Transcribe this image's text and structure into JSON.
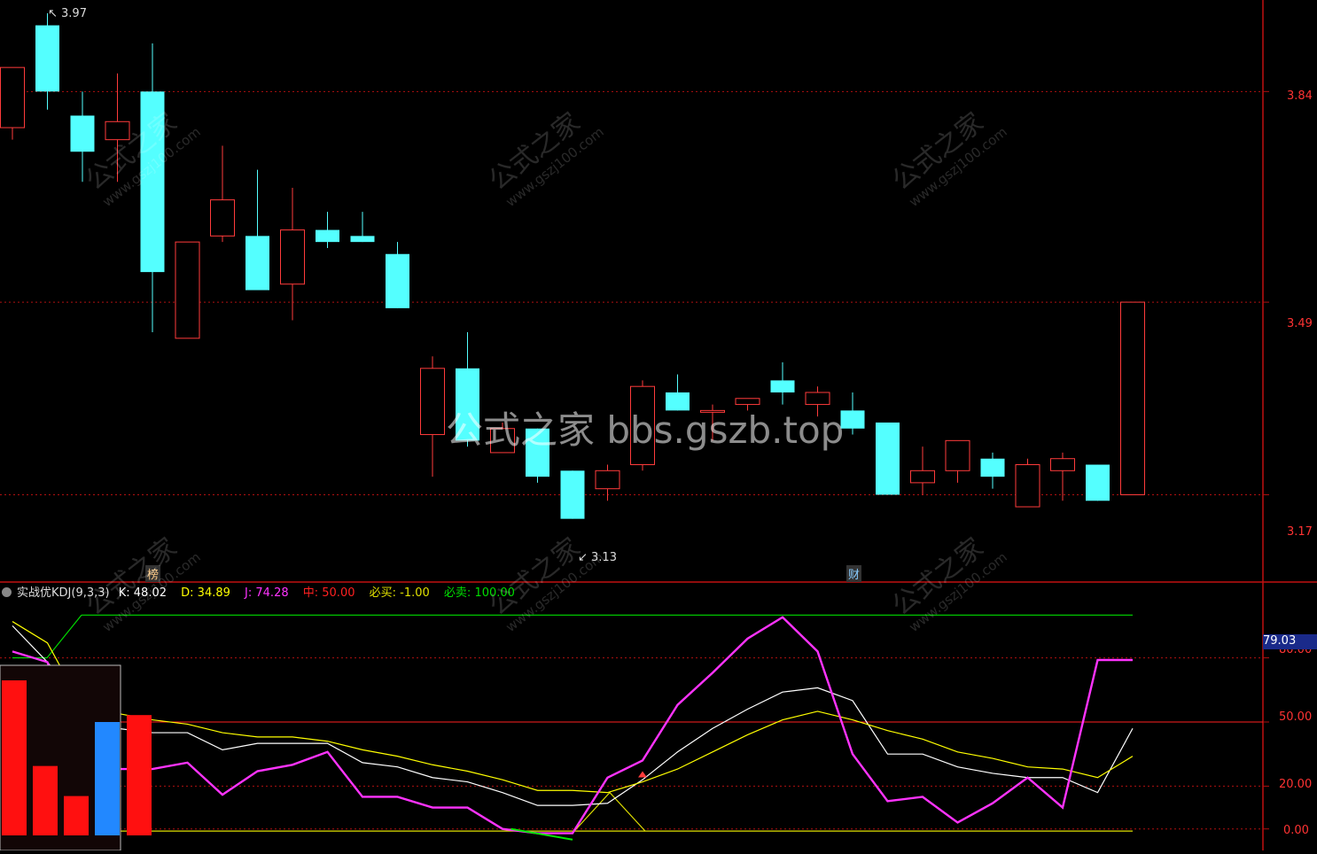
{
  "colors": {
    "up": "#ff3b3b",
    "down": "#54ffff",
    "k_line": "#ffffff",
    "d_line": "#ffff00",
    "j_line": "#ff33ff",
    "mid_line": "#ff2020",
    "sell_line": "#00dd00",
    "buy_line": "#e0e000",
    "grid": "#b01010",
    "bars_red": "#ff1010",
    "bars_blue": "#2288ff"
  },
  "watermark": {
    "center": "公式之家 bbs.gszb.top",
    "diagonal_cn": "公式之家",
    "diagonal_url": "www.gszj100.com"
  },
  "chart_data": [
    {
      "type": "candlestick",
      "title": "",
      "y_axis_labels": [
        "3.84",
        "3.49",
        "3.17"
      ],
      "ylim": [
        3.05,
        3.97
      ],
      "high_label": "3.97",
      "low_label": "3.13",
      "candles": [
        {
          "o": 3.78,
          "h": 3.86,
          "l": 3.76,
          "c": 3.88
        },
        {
          "o": 3.95,
          "h": 3.97,
          "l": 3.81,
          "c": 3.84
        },
        {
          "o": 3.8,
          "h": 3.84,
          "l": 3.69,
          "c": 3.74
        },
        {
          "o": 3.76,
          "h": 3.87,
          "l": 3.69,
          "c": 3.79
        },
        {
          "o": 3.84,
          "h": 3.92,
          "l": 3.44,
          "c": 3.54
        },
        {
          "o": 3.43,
          "h": 3.58,
          "l": 3.44,
          "c": 3.59
        },
        {
          "o": 3.6,
          "h": 3.75,
          "l": 3.59,
          "c": 3.66
        },
        {
          "o": 3.6,
          "h": 3.71,
          "l": 3.51,
          "c": 3.51
        },
        {
          "o": 3.52,
          "h": 3.68,
          "l": 3.46,
          "c": 3.61
        },
        {
          "o": 3.61,
          "h": 3.64,
          "l": 3.58,
          "c": 3.59
        },
        {
          "o": 3.6,
          "h": 3.64,
          "l": 3.59,
          "c": 3.59
        },
        {
          "o": 3.57,
          "h": 3.59,
          "l": 3.48,
          "c": 3.48
        },
        {
          "o": 3.27,
          "h": 3.4,
          "l": 3.2,
          "c": 3.38
        },
        {
          "o": 3.38,
          "h": 3.44,
          "l": 3.25,
          "c": 3.26
        },
        {
          "o": 3.24,
          "h": 3.29,
          "l": 3.26,
          "c": 3.28
        },
        {
          "o": 3.28,
          "h": 3.28,
          "l": 3.19,
          "c": 3.2
        },
        {
          "o": 3.21,
          "h": 3.21,
          "l": 3.13,
          "c": 3.13
        },
        {
          "o": 3.18,
          "h": 3.22,
          "l": 3.16,
          "c": 3.21
        },
        {
          "o": 3.22,
          "h": 3.36,
          "l": 3.21,
          "c": 3.35
        },
        {
          "o": 3.34,
          "h": 3.37,
          "l": 3.31,
          "c": 3.31
        },
        {
          "o": 3.31,
          "h": 3.32,
          "l": 3.26,
          "c": 3.31
        },
        {
          "o": 3.32,
          "h": 3.33,
          "l": 3.31,
          "c": 3.33
        },
        {
          "o": 3.36,
          "h": 3.39,
          "l": 3.32,
          "c": 3.34
        },
        {
          "o": 3.32,
          "h": 3.35,
          "l": 3.3,
          "c": 3.34
        },
        {
          "o": 3.31,
          "h": 3.34,
          "l": 3.27,
          "c": 3.28
        },
        {
          "o": 3.29,
          "h": 3.29,
          "l": 3.17,
          "c": 3.17
        },
        {
          "o": 3.19,
          "h": 3.25,
          "l": 3.17,
          "c": 3.21
        },
        {
          "o": 3.21,
          "h": 3.24,
          "l": 3.19,
          "c": 3.26
        },
        {
          "o": 3.23,
          "h": 3.24,
          "l": 3.18,
          "c": 3.2
        },
        {
          "o": 3.15,
          "h": 3.23,
          "l": 3.15,
          "c": 3.22
        },
        {
          "o": 3.21,
          "h": 3.24,
          "l": 3.16,
          "c": 3.23
        },
        {
          "o": 3.22,
          "h": 3.22,
          "l": 3.16,
          "c": 3.16
        },
        {
          "o": 3.17,
          "h": 3.49,
          "l": 3.17,
          "c": 3.49
        }
      ],
      "markers": [
        {
          "index": 4,
          "text": "榜"
        },
        {
          "index": 24,
          "text": "财"
        }
      ]
    },
    {
      "type": "line",
      "title": "实战优KDJ(9,3,3)",
      "legend": [
        {
          "name": "K",
          "value": "48.02"
        },
        {
          "name": "D",
          "value": "34.89"
        },
        {
          "name": "J",
          "value": "74.28"
        },
        {
          "name": "中",
          "value": "50.00"
        },
        {
          "name": "必买",
          "value": "-1.00"
        },
        {
          "name": "必卖",
          "value": "100.00"
        }
      ],
      "y_axis_labels": [
        "80.00",
        "50.00",
        "20.00",
        "0.00"
      ],
      "last_value_label": "79.03",
      "ylim": [
        -8,
        108
      ],
      "series": [
        {
          "name": "K",
          "values": [
            95,
            78,
            58,
            47,
            45,
            45,
            37,
            40,
            40,
            40,
            31,
            29,
            24,
            22,
            17,
            11,
            11,
            12,
            23,
            36,
            47,
            56,
            64,
            66,
            60,
            35,
            35,
            29,
            26,
            24,
            24,
            17,
            47
          ]
        },
        {
          "name": "D",
          "values": [
            97,
            87,
            57,
            54,
            51,
            49,
            45,
            43,
            43,
            41,
            37,
            34,
            30,
            27,
            23,
            18,
            18,
            17,
            22,
            28,
            36,
            44,
            51,
            55,
            51,
            46,
            42,
            36,
            33,
            29,
            28,
            24,
            34
          ]
        },
        {
          "name": "J",
          "values": [
            83,
            78,
            34,
            28,
            28,
            31,
            16,
            27,
            30,
            36,
            15,
            15,
            10,
            10,
            0,
            -2,
            -2,
            24,
            32,
            58,
            73,
            89,
            99,
            83,
            35,
            13,
            15,
            3,
            12,
            24,
            10,
            79,
            79
          ]
        },
        {
          "name": "中",
          "values": [
            50
          ]
        },
        {
          "name": "必买",
          "values": [
            -1
          ]
        },
        {
          "name": "必卖",
          "values": [
            100
          ]
        }
      ]
    }
  ],
  "volume_bars": {
    "values": [
      67,
      30,
      17,
      49,
      52
    ],
    "blue_index": 3
  }
}
